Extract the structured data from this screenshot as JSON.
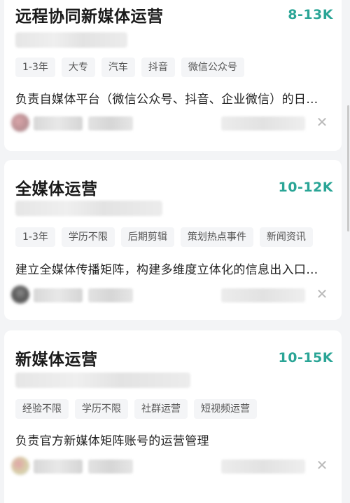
{
  "jobs": [
    {
      "title": "远程协同新媒体运营",
      "salary": "8-13K",
      "tags": [
        "1-3年",
        "大专",
        "汽车",
        "抖音",
        "微信公众号"
      ],
      "description": "负责自媒体平台（微信公众号、抖音、企业微信）的日…",
      "close_glyph": "✕"
    },
    {
      "title": "全媒体运营",
      "salary": "10-12K",
      "tags": [
        "1-3年",
        "学历不限",
        "后期剪辑",
        "策划热点事件",
        "新闻资讯"
      ],
      "description": "建立全媒体传播矩阵，构建多维度立体化的信息出入口…",
      "close_glyph": "✕"
    },
    {
      "title": "新媒体运营",
      "salary": "10-15K",
      "tags": [
        "经验不限",
        "学历不限",
        "社群运营",
        "短视频运营"
      ],
      "description": "负责官方新媒体矩阵账号的运营管理",
      "close_glyph": "✕"
    }
  ],
  "colors": {
    "salary": "#2aa596",
    "background": "#f3f4f6",
    "card": "#ffffff",
    "tag_bg": "#f4f5f7"
  }
}
